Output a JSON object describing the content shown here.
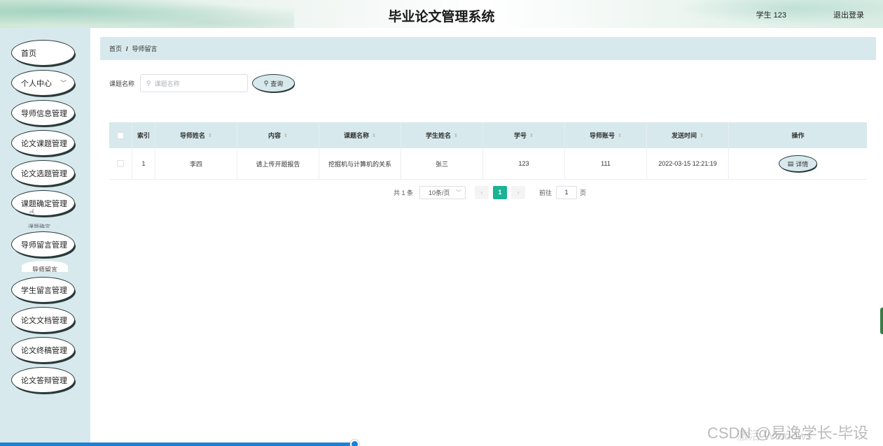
{
  "header": {
    "title": "毕业论文管理系统",
    "user": "学生 123",
    "logout": "退出登录"
  },
  "sidebar": {
    "items": [
      {
        "label": "首页"
      },
      {
        "label": "个人中心",
        "has_dropdown": true
      },
      {
        "label": "导师信息管理"
      },
      {
        "label": "论文课题管理"
      },
      {
        "label": "论文选题管理"
      },
      {
        "label": "课题确定管理"
      },
      {
        "label": "导师留言管理"
      },
      {
        "label": "学生留言管理"
      },
      {
        "label": "论文文档管理"
      },
      {
        "label": "论文终稿管理"
      },
      {
        "label": "论文答辩管理"
      }
    ],
    "submenu_peek": "导师留言",
    "submenu_peek_above": "课题确定"
  },
  "breadcrumb": {
    "home": "首页",
    "separator": "/",
    "current": "导师留言"
  },
  "search": {
    "label": "课题名称",
    "placeholder": "课题名称",
    "button": "查询"
  },
  "table": {
    "columns": [
      "索引",
      "导师姓名",
      "内容",
      "课题名称",
      "学生姓名",
      "学号",
      "导师账号",
      "发送时间",
      "操作"
    ],
    "sortable": [
      false,
      true,
      true,
      true,
      true,
      true,
      true,
      true,
      false
    ],
    "rows": [
      {
        "index": "1",
        "teacher_name": "李四",
        "content": "请上传开题报告",
        "topic": "挖掘机与计算机的关系",
        "student_name": "张三",
        "student_id": "123",
        "teacher_account": "111",
        "sent_time": "2022-03-15 12:21:19",
        "action": "详情"
      }
    ]
  },
  "pagination": {
    "total": "共 1 条",
    "page_size": "10条/页",
    "current_page": "1",
    "goto_label": "前往",
    "goto_value": "1",
    "page_unit": "页"
  },
  "watermark": "CSDN @易逸学长-毕设",
  "watermark_overlay": "激活 Windows",
  "colors": {
    "accent": "#1ab394",
    "panel": "#d7e9ec",
    "scrollbar": "#1a82d6"
  }
}
